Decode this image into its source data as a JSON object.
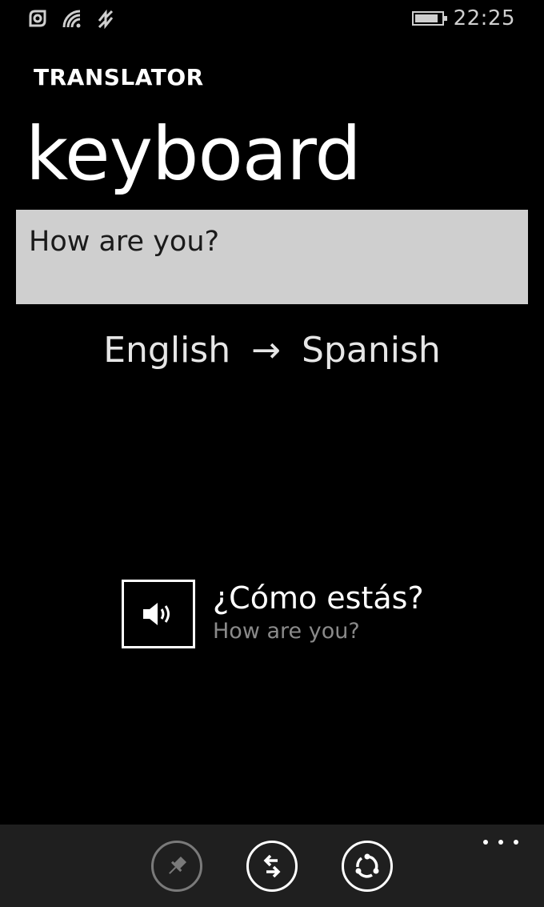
{
  "status_bar": {
    "time": "22:25",
    "battery_level": 0.9,
    "icons": [
      "nfc-icon",
      "wifi-icon",
      "data-connection-icon",
      "battery-icon"
    ]
  },
  "app": {
    "title": "TRANSLATOR",
    "page_title": "keyboard"
  },
  "input": {
    "value": "How are you?"
  },
  "language": {
    "source": "English",
    "arrow": "→",
    "target": "Spanish"
  },
  "result": {
    "translation": "¿Cómo estás?",
    "source_text": "How are you?"
  },
  "app_bar": {
    "buttons": [
      "pin-icon",
      "swap-languages-icon",
      "refresh-icon"
    ],
    "more": "more-options-icon"
  },
  "colors": {
    "background": "#000000",
    "input_background": "#cfcfcf",
    "secondary_text": "#8a8a8a",
    "app_bar": "#1f1f1f"
  }
}
